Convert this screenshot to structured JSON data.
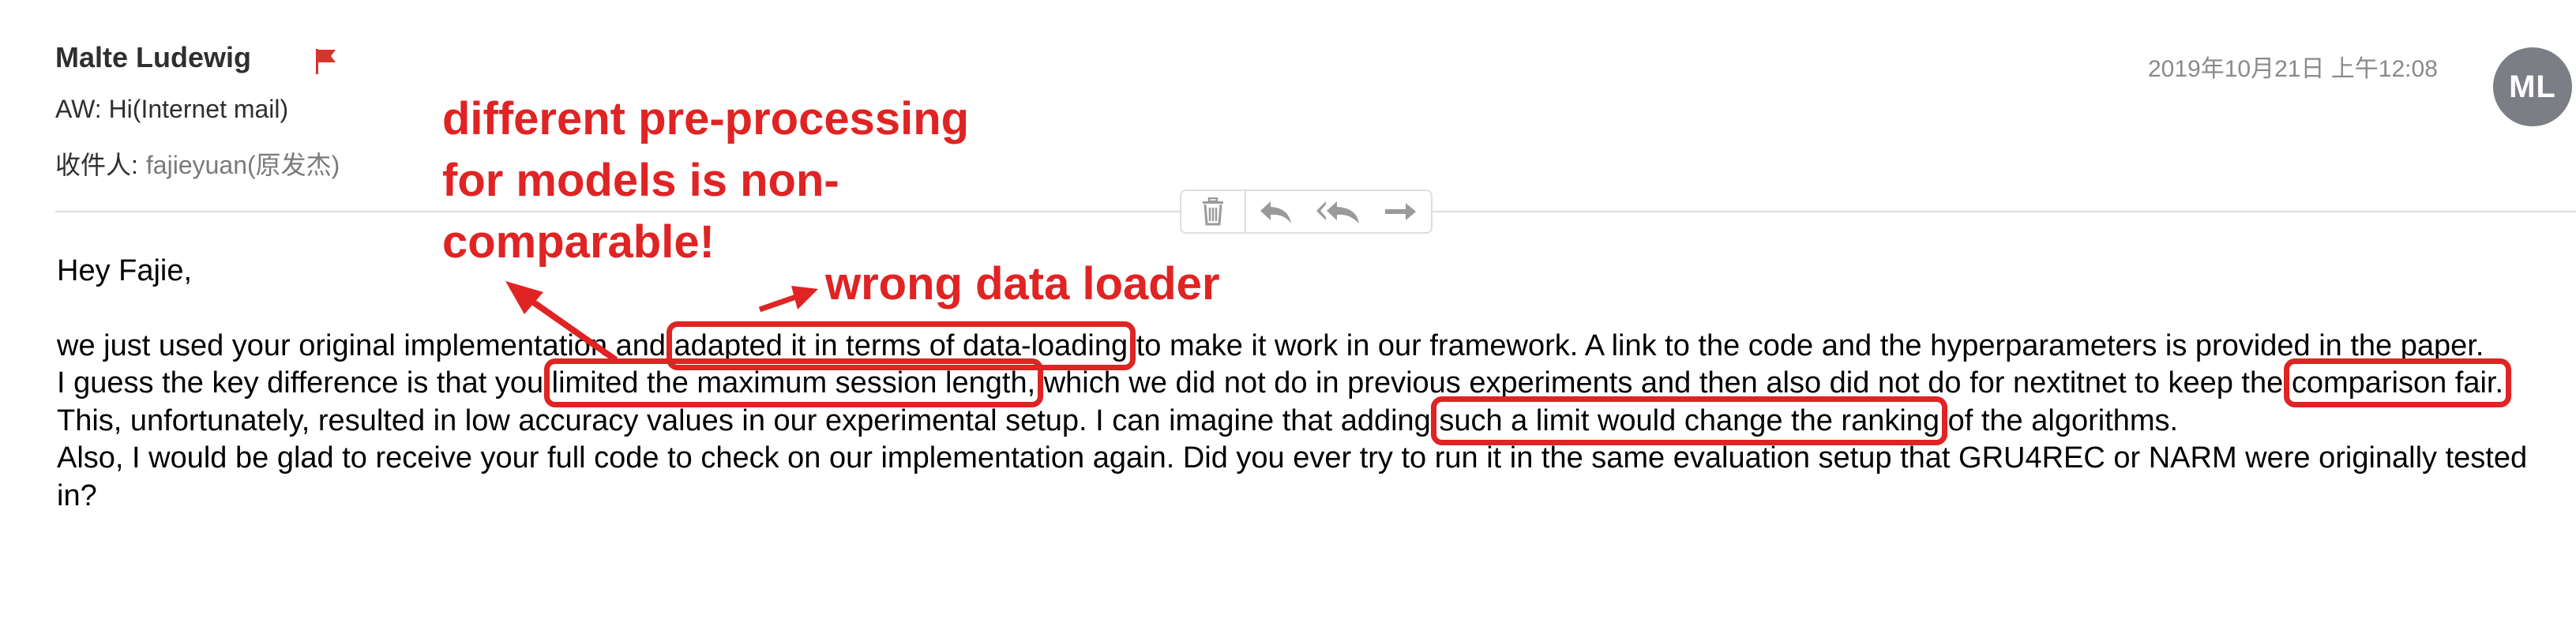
{
  "email": {
    "sender": "Malte Ludewig",
    "subject": "AW: Hi(Internet mail)",
    "recipient_label": "收件人:",
    "recipient": "fajieyuan(原发杰)",
    "timestamp": "2019年10月21日 上午12:08",
    "avatar_initials": "ML"
  },
  "toolbar": {
    "icons": [
      "trash-icon",
      "reply-icon",
      "reply-all-icon",
      "forward-icon"
    ]
  },
  "body": {
    "greeting": "Hey Fajie,",
    "p1_a": "we just used your original implementation and ",
    "p1_highlight": "adapted it in terms of data-loading",
    "p1_b": " to make it work in our framework. A link to the code and the hyperparameters is provided in the paper.",
    "p2_a": "I guess the key difference is that you ",
    "p2_highlight1": "limited the maximum session length,",
    "p2_b": " which we did not do in previous experiments and then also did not do for nextitnet to keep the ",
    "p2_highlight2": "comparison fair.",
    "p2_c": " This, unfortunately, resulted in low accuracy values in our experimental setup. I can imagine that adding ",
    "p2_highlight3": "such a limit would change the ranking",
    "p2_d": " of the algorithms.",
    "p3": "Also, I would be glad to receive your full code to check on our implementation again. Did you ever try to run it in the same evaluation setup that GRU4REC or NARM were originally tested in?"
  },
  "annotations": {
    "preprocessing_line1": "different pre-processing",
    "preprocessing_line2": "for models  is non-",
    "preprocessing_line3": "comparable!",
    "data_loader": "wrong data loader"
  },
  "colors": {
    "annotation_red": "#e02323",
    "flag_red": "#d9342b",
    "avatar_bg": "#7b7e85"
  }
}
